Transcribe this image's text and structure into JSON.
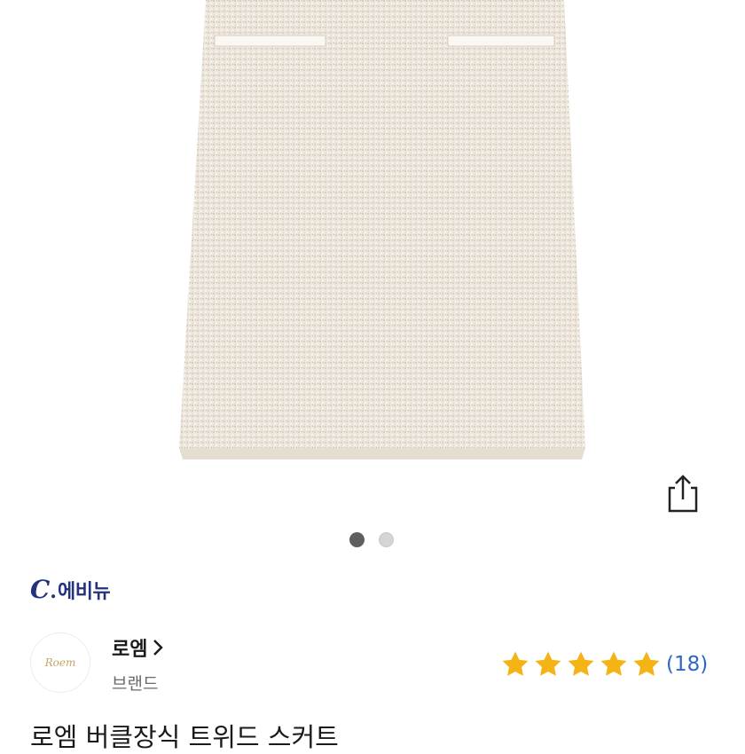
{
  "product_image": {
    "subject": "tweed mini skirt",
    "carousel": {
      "total": 2,
      "active_index": 0
    }
  },
  "store": {
    "logo_c": "C",
    "logo_dot": ".",
    "logo_name": "에비뉴",
    "logo_color": "#23327a"
  },
  "brand": {
    "avatar_text": "Roem",
    "name": "로엠",
    "caption": "브랜드"
  },
  "rating": {
    "stars": 5,
    "max_stars": 5,
    "star_color": "#f5b416",
    "review_count": "(18)",
    "link_color": "#2f66c8"
  },
  "product": {
    "title": "로엠 버클장식 트위드 스커트"
  },
  "icons": {
    "share": "share-icon",
    "chevron": "chevron-right-icon"
  }
}
